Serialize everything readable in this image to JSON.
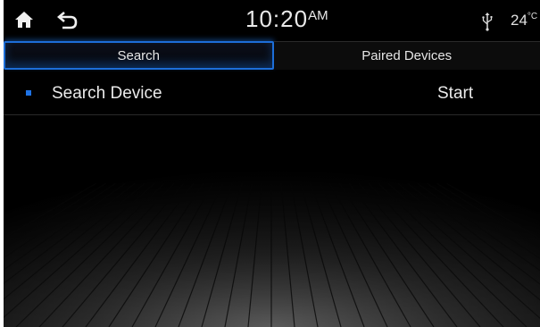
{
  "status_bar": {
    "time": "10:20",
    "ampm": "AM",
    "temperature": "24",
    "temperature_unit": "°C",
    "icons": [
      "home-icon",
      "back-icon",
      "usb-icon"
    ]
  },
  "tabs": [
    {
      "label": "Search",
      "active": true
    },
    {
      "label": "Paired Devices",
      "active": false
    }
  ],
  "list": [
    {
      "label": "Search Device",
      "action": "Start"
    }
  ],
  "colors": {
    "accent": "#1e73e6",
    "background": "#000000",
    "text": "#eaeaea"
  }
}
